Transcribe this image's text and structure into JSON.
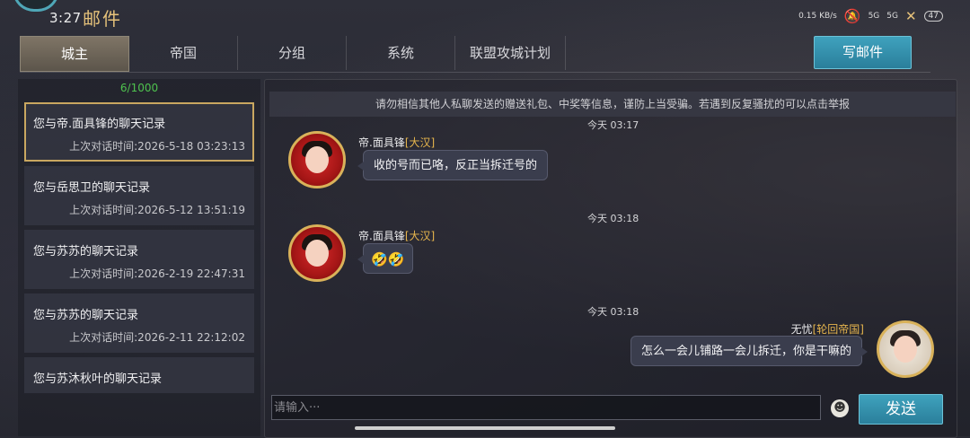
{
  "status_bar": {
    "time": "3:27",
    "net_speed": "0.15 KB/s",
    "signal1": "5G",
    "signal2": "5G",
    "battery": "47"
  },
  "window": {
    "title": "邮件"
  },
  "tabs": [
    {
      "label": "城主",
      "active": true
    },
    {
      "label": "帝国",
      "active": false
    },
    {
      "label": "分组",
      "active": false
    },
    {
      "label": "系统",
      "active": false
    },
    {
      "label": "联盟攻城计划",
      "active": false
    }
  ],
  "compose_label": "写邮件",
  "counter": "6/1000",
  "conversations": [
    {
      "title": "您与帝.面具锋的聊天记录",
      "time": "上次对话时间:2026-5-18   03:23:13",
      "selected": true
    },
    {
      "title": "您与岳思卫的聊天记录",
      "time": "上次对话时间:2026-5-12   13:51:19",
      "selected": false
    },
    {
      "title": "您与苏苏的聊天记录",
      "time": "上次对话时间:2026-2-19   22:47:31",
      "selected": false
    },
    {
      "title": "您与苏苏的聊天记录",
      "time": "上次对话时间:2026-2-11   22:12:02",
      "selected": false
    },
    {
      "title": "您与苏沐秋叶的聊天记录",
      "time": "",
      "selected": false
    }
  ],
  "notice": "请勿相信其他人私聊发送的赠送礼包、中奖等信息，谨防上当受骗。若遇到反复骚扰的可以点击举报",
  "messages": [
    {
      "time": "今天 03:17",
      "sender": "帝.面具锋",
      "tag": "[大汉]",
      "text": "收的号而已咯，反正当拆迁号的"
    },
    {
      "time": "今天 03:18",
      "sender": "帝.面具锋",
      "tag": "[大汉]",
      "text": ""
    },
    {
      "time": "今天 03:18",
      "sender": "无忧",
      "tag": "[轮回帝国]",
      "text": "怎么一会儿铺路一会儿拆迁，你是干嘛的"
    }
  ],
  "input": {
    "placeholder": "请输入···"
  },
  "send_label": "发送",
  "colors": {
    "accent_gold": "#e6c27a",
    "button_teal": "#2a7f9b",
    "counter_green": "#4ec24e",
    "tag_gold": "#e6b54d"
  }
}
